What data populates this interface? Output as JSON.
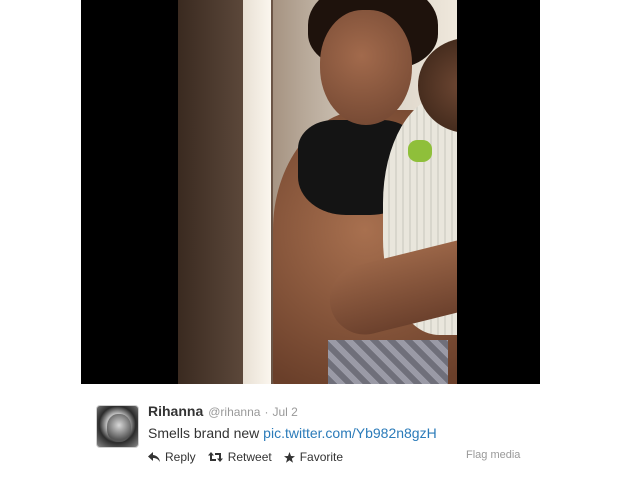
{
  "tweet": {
    "name": "Rihanna",
    "handle": "@rihanna",
    "separator": "·",
    "date": "Jul 2",
    "text": "Smells brand new",
    "link": "pic.twitter.com/Yb982n8gzH"
  },
  "actions": {
    "reply": "Reply",
    "retweet": "Retweet",
    "favorite": "Favorite"
  },
  "flag_media": "Flag media",
  "icons": {
    "reply": "reply-arrow-icon",
    "retweet": "retweet-icon",
    "favorite": "star-icon"
  },
  "colors": {
    "link": "#2b7bb9",
    "muted": "#999999",
    "text": "#333333",
    "media_background": "#000000"
  }
}
